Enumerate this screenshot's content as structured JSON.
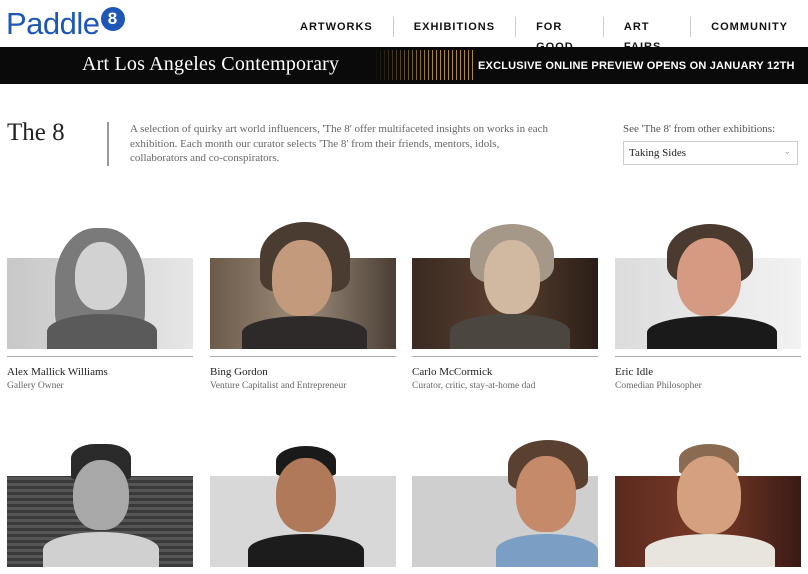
{
  "logo": {
    "text": "Paddle",
    "badge": "8"
  },
  "nav": [
    "ARTWORKS",
    "EXHIBITIONS",
    "FOR GOOD",
    "ART FAIRS",
    "COMMUNITY"
  ],
  "banner": {
    "title": "Art Los Angeles Contemporary",
    "cta": "EXCLUSIVE ONLINE PREVIEW OPENS ON JANUARY 12TH"
  },
  "intro": {
    "title": "The 8",
    "description": "A selection of quirky art world influencers, 'The 8' offer multifaceted insights on works in each exhibition. Each month our curator selects 'The 8' from their friends, mentors, idols, collaborators and co-conspirators.",
    "other_label": "See 'The 8' from other exhibitions:",
    "select_value": "Taking Sides"
  },
  "people": [
    {
      "name": "Alex Mallick Williams",
      "role": "Gallery Owner"
    },
    {
      "name": "Bing Gordon",
      "role": "Venture Capitalist and Entrepreneur"
    },
    {
      "name": "Carlo McCormick",
      "role": "Curator, critic, stay-at-home dad"
    },
    {
      "name": "Eric Idle",
      "role": "Comedian Philosopher"
    },
    {
      "name": "",
      "role": ""
    },
    {
      "name": "",
      "role": ""
    },
    {
      "name": "",
      "role": ""
    },
    {
      "name": "",
      "role": ""
    }
  ]
}
